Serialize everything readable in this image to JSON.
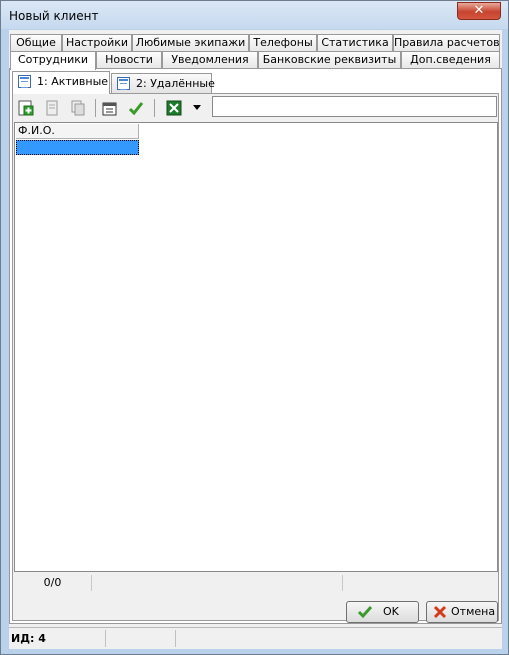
{
  "window": {
    "title": "Новый клиент",
    "close_glyph": "✕"
  },
  "tabs_row1": [
    "Общие",
    "Настройки",
    "Любимые экипажи",
    "Телефоны",
    "Статистика",
    "Правила расчетов"
  ],
  "tabs_row2": [
    "Сотрудники",
    "Новости",
    "Уведомления",
    "Банковские реквизиты",
    "Доп.сведения"
  ],
  "subtabs": [
    "1: Активные",
    "2: Удалённые"
  ],
  "toolbar": {
    "icons": [
      "add-icon",
      "edit-icon",
      "copy-icon",
      "properties-icon",
      "check-icon",
      "excel-icon",
      "dropdown-arrow-icon"
    ]
  },
  "grid": {
    "columns": [
      "Ф.И.О."
    ],
    "rows": [
      [
        ""
      ]
    ]
  },
  "grid_status": {
    "counter": "0/0"
  },
  "buttons": {
    "ok": "OK",
    "cancel": "Отмена"
  },
  "statusbar": {
    "id_text": "ИД: 4"
  },
  "colors": {
    "selection": "#3399ff",
    "window_frame": "#b9d1ea",
    "close_button": "#c7442f"
  }
}
